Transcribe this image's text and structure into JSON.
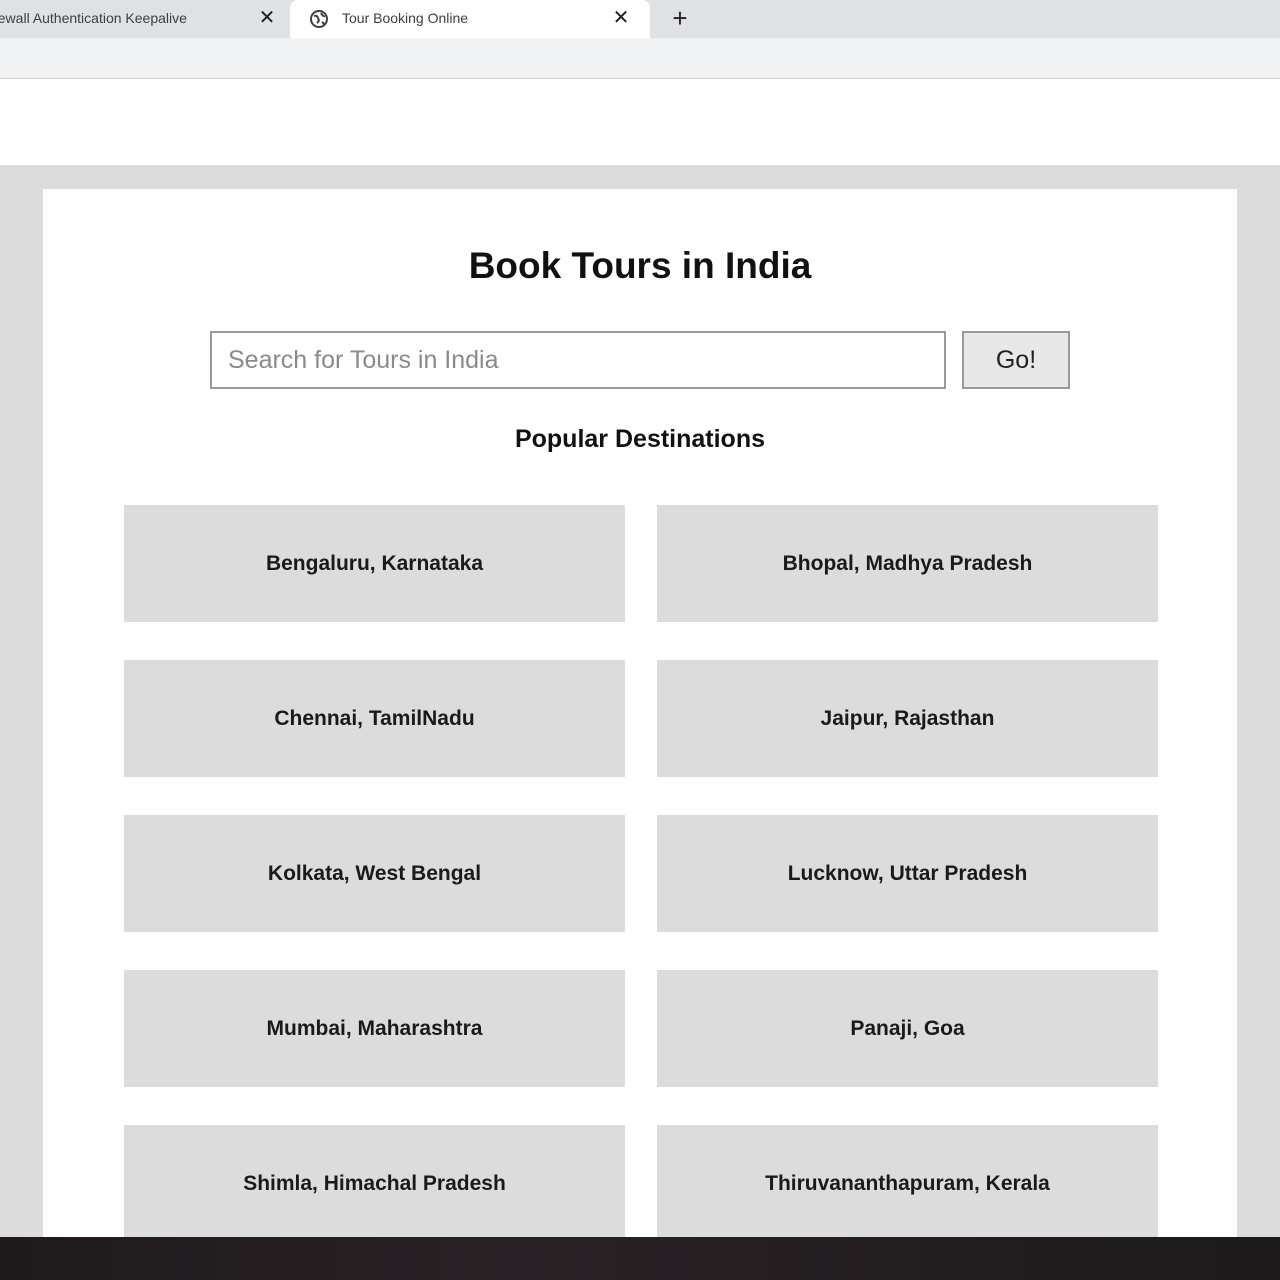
{
  "browser": {
    "tabs": [
      {
        "title": "irewall Authentication Keepalive",
        "active": false
      },
      {
        "title": "Tour Booking Online",
        "active": true
      }
    ],
    "close_symbol": "✕",
    "new_tab_symbol": "+"
  },
  "page": {
    "title": "Book Tours in India",
    "search": {
      "placeholder": "Search for Tours in India",
      "value": ""
    },
    "go_button": "Go!",
    "section_title": "Popular Destinations",
    "destinations": [
      "Bengaluru, Karnataka",
      "Bhopal, Madhya Pradesh",
      "Chennai, TamilNadu",
      "Jaipur, Rajasthan",
      "Kolkata, West Bengal",
      "Lucknow, Uttar Pradesh",
      "Mumbai, Maharashtra",
      "Panaji, Goa",
      "Shimla, Himachal Pradesh",
      "Thiruvananthapuram, Kerala"
    ]
  },
  "colors": {
    "page_background": "#dcdcdc",
    "card_background": "#dcdcdc",
    "container": "#ffffff"
  }
}
